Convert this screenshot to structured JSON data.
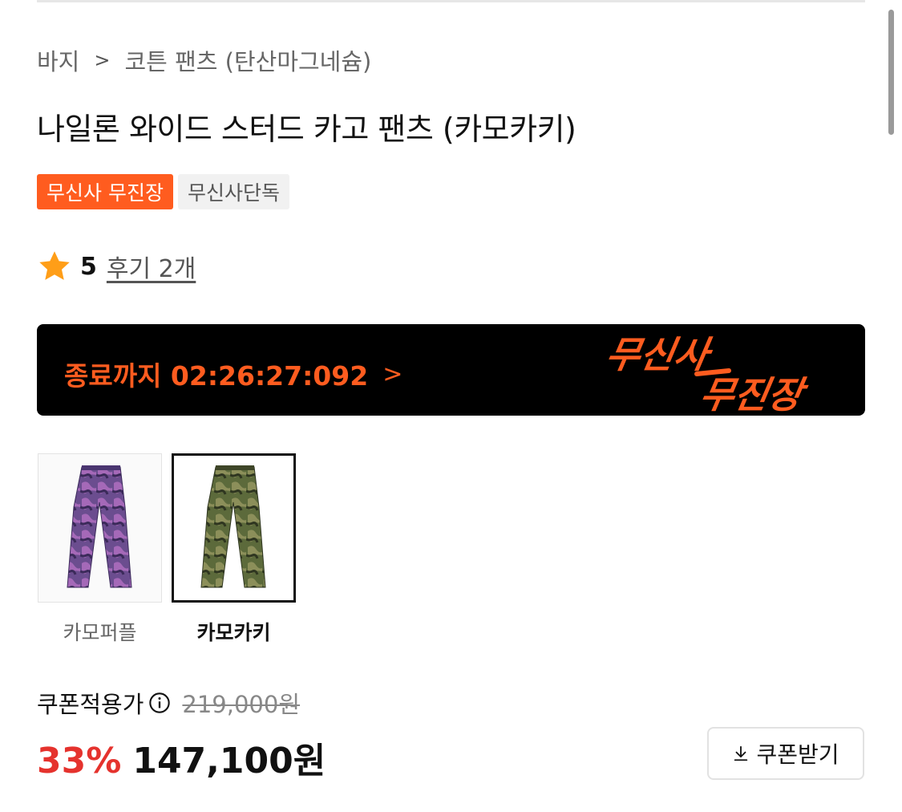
{
  "breadcrumb": {
    "items": [
      "바지",
      "코튼 팬츠 (탄산마그네슘)"
    ],
    "separator": ">"
  },
  "product": {
    "title": "나일론 와이드 스터드 카고 팬츠 (카모카키)"
  },
  "badges": [
    {
      "label": "무신사 무진장",
      "color": "#ff5c1f"
    },
    {
      "label": "무신사단독"
    }
  ],
  "rating": {
    "score": "5",
    "reviews_label": "후기 2개",
    "icon": "star-icon"
  },
  "deal_banner": {
    "countdown_label": "종료까지 02:26:27:092",
    "chevron": ">",
    "logo_lines": [
      "무신사",
      "무진장"
    ]
  },
  "colors": {
    "options": [
      {
        "label": "카모퍼플",
        "selected": false,
        "tone": "#6b4d8f"
      },
      {
        "label": "카모카키",
        "selected": true,
        "tone": "#5c6a3b"
      }
    ]
  },
  "pricing": {
    "coupon_label": "쿠폰적용가",
    "original_price": "219,000원",
    "discount_rate": "33%",
    "final_price": "147,100원",
    "coupon_button_label": "쿠폰받기"
  },
  "theme": {
    "accent": "#ff5c1f",
    "discount_red": "#e5322d"
  }
}
